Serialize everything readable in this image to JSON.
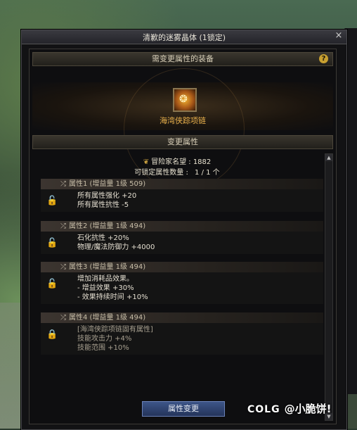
{
  "window": {
    "title": "清歉的迷雾晶体 (1锁定)",
    "close": "×"
  },
  "equip_section": {
    "header": "需变更属性的装备",
    "help": "?",
    "item_name": "海湾侠踪项链"
  },
  "change_section": {
    "header": "变更属性"
  },
  "reputation": {
    "label": "冒险家名望 : 1882"
  },
  "lock_count": {
    "label": "可锁定属性数量 :",
    "value": "1 / 1 个"
  },
  "attributes": [
    {
      "title": "属性1 (增益量 1级 509)",
      "lines": [
        "所有属性强化 +20",
        "所有属性抗性 -5"
      ],
      "lock": "open"
    },
    {
      "title": "属性2 (增益量 1级 494)",
      "lines": [
        "石化抗性 +20%",
        "物理/魔法防御力 +4000"
      ],
      "lock": "open"
    },
    {
      "title": "属性3 (增益量 1级 494)",
      "lines": [
        "增加消耗品效果。",
        "- 增益效果 +30%",
        "- 效果持续时间 +10%"
      ],
      "lock": "open"
    },
    {
      "title": "属性4 (增益量 1级 494)",
      "lines": [
        "[海湾侠踪项链固有属性]",
        "技能攻击力 +4%",
        "技能范围 +10%"
      ],
      "lock": "locked"
    }
  ],
  "button": {
    "label": "属性变更"
  },
  "watermark": {
    "logo": "COLG",
    "text": "@小脆饼!"
  },
  "colors": {
    "accent_gold": "#e8b04c",
    "lock_open": "#e8c030",
    "lock_closed": "#e04848",
    "button_blue": "#3d5588"
  }
}
